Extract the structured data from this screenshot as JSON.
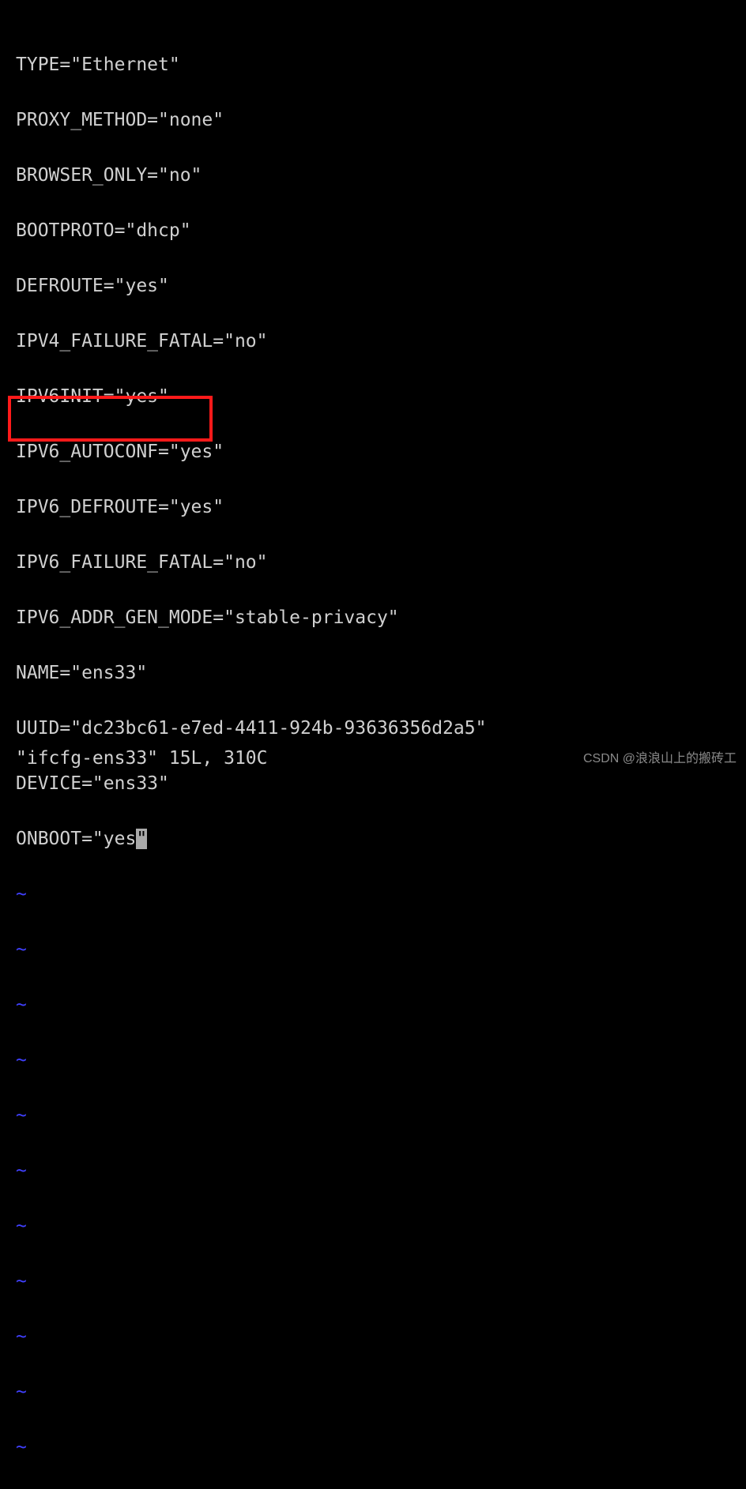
{
  "editor": {
    "lines": [
      "TYPE=\"Ethernet\"",
      "PROXY_METHOD=\"none\"",
      "BROWSER_ONLY=\"no\"",
      "BOOTPROTO=\"dhcp\"",
      "DEFROUTE=\"yes\"",
      "IPV4_FAILURE_FATAL=\"no\"",
      "IPV6INIT=\"yes\"",
      "IPV6_AUTOCONF=\"yes\"",
      "IPV6_DEFROUTE=\"yes\"",
      "IPV6_FAILURE_FATAL=\"no\"",
      "IPV6_ADDR_GEN_MODE=\"stable-privacy\"",
      "NAME=\"ens33\"",
      "UUID=\"dc23bc61-e7ed-4411-924b-93636356d2a5\"",
      "DEVICE=\"ens33\""
    ],
    "highlighted_line_prefix": "ONBOOT=\"yes",
    "highlighted_line_cursor": "\"",
    "tilde": "~",
    "tilde_count": 11
  },
  "status": "\"ifcfg-ens33\" 15L, 310C",
  "watermark": "CSDN @浪浪山上的搬砖工"
}
